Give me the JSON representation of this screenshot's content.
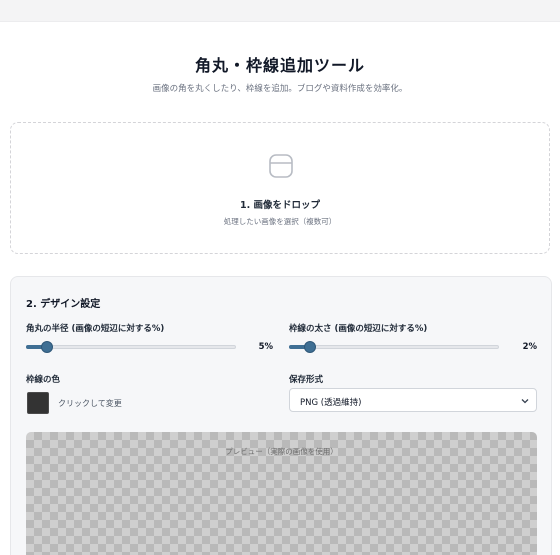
{
  "header": {
    "title": "角丸・枠線追加ツール",
    "subtitle": "画像の角を丸くしたり、枠線を追加。ブログや資料作成を効率化。"
  },
  "dropzone": {
    "title": "1. 画像をドロップ",
    "hint": "処理したい画像を選択（複数可）",
    "icon": "image-frame-icon"
  },
  "settings": {
    "title": "2. デザイン設定",
    "radius": {
      "label": "角丸の半径 (画像の短辺に対する%)",
      "value": 5,
      "display": "5%"
    },
    "border_width": {
      "label": "枠線の太さ (画像の短辺に対する%)",
      "value": 2,
      "display": "2%"
    },
    "border_color": {
      "label": "枠線の色",
      "color": "#333333",
      "hint": "クリックして変更"
    },
    "format": {
      "label": "保存形式",
      "selected": "PNG (透過維持)"
    }
  },
  "preview": {
    "label": "プレビュー（実際の画像を使用）"
  },
  "colors": {
    "accent": "#3f6f94"
  }
}
